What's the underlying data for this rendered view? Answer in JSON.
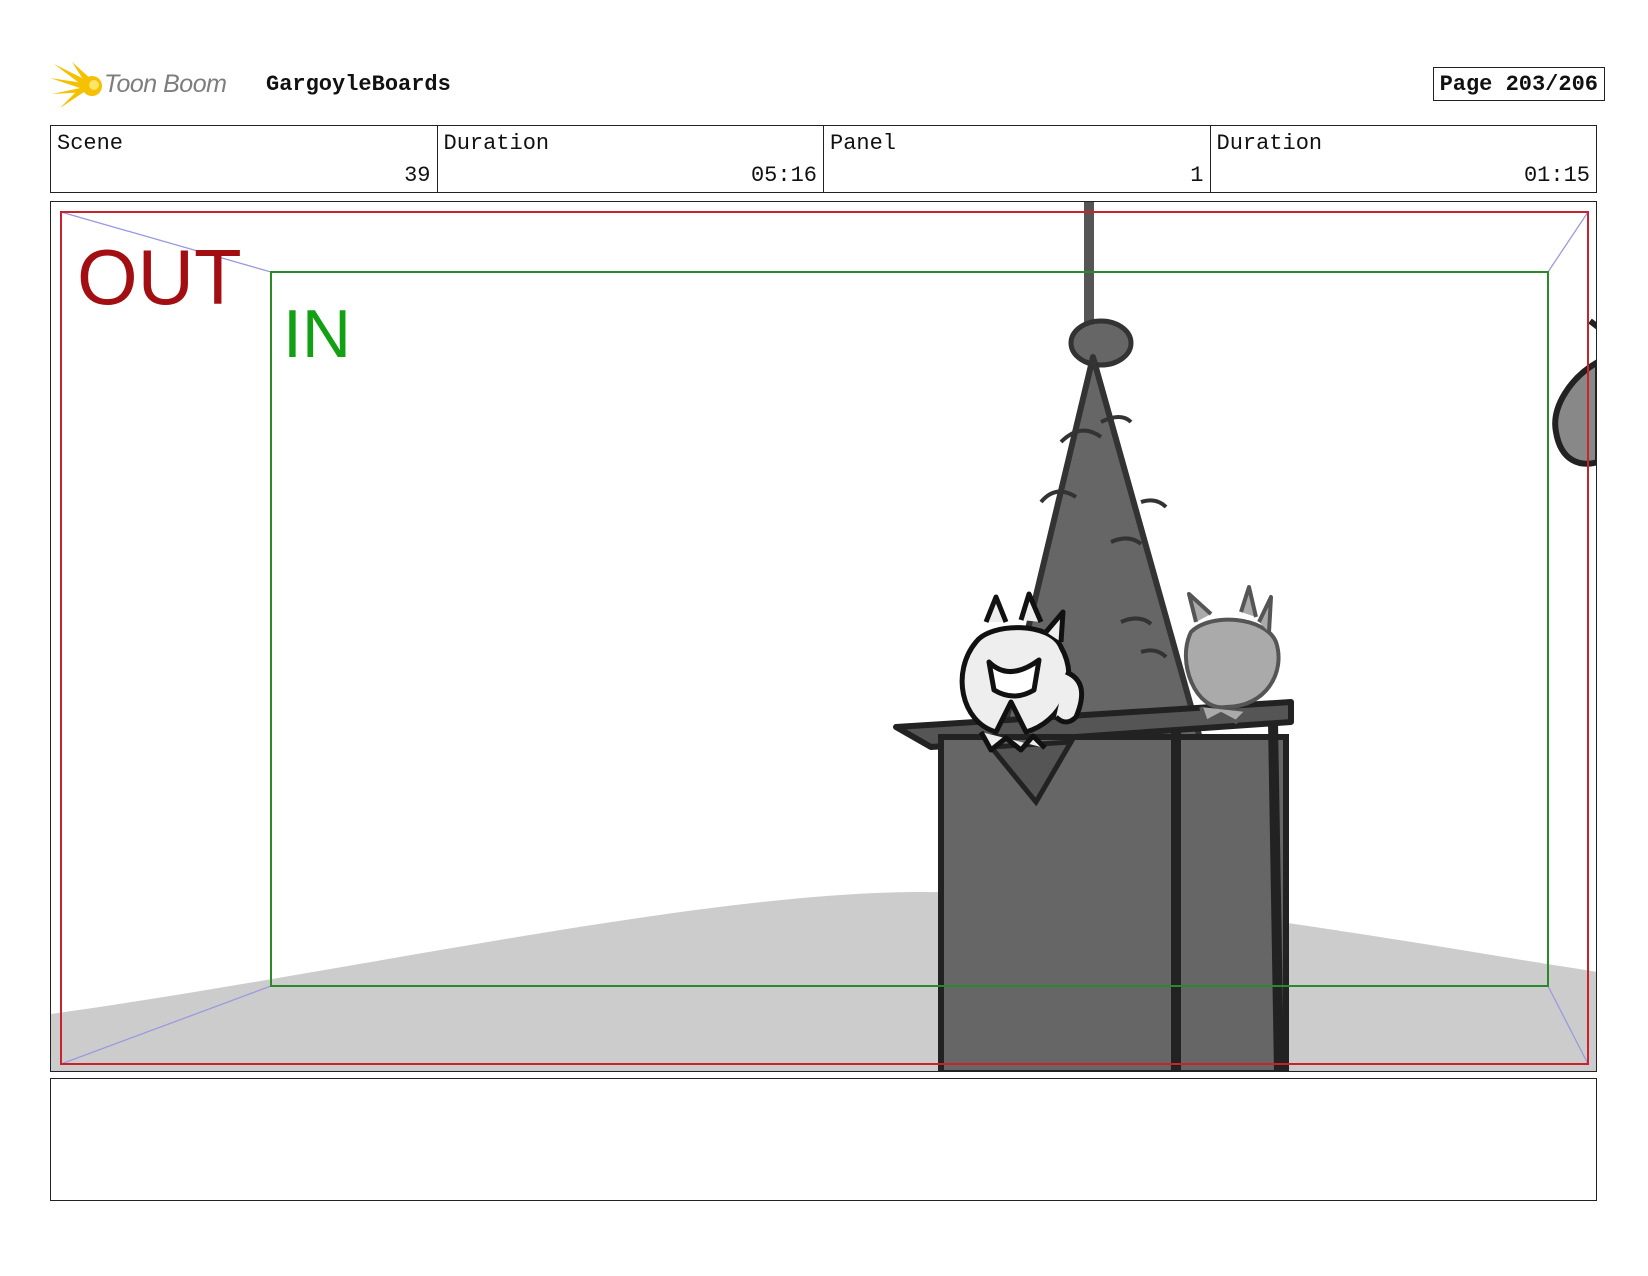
{
  "header": {
    "brand": "Toon Boom",
    "project": "GargoyleBoards",
    "page_label": "Page 203/206"
  },
  "info": [
    {
      "label": "Scene",
      "value": "39"
    },
    {
      "label": "Duration",
      "value": "05:16"
    },
    {
      "label": "Panel",
      "value": "1"
    },
    {
      "label": "Duration",
      "value": "01:15"
    }
  ],
  "panel": {
    "out_label": "OUT",
    "in_label": "IN"
  },
  "notes": {
    "text": ""
  },
  "colors": {
    "out_frame": "#c8232c",
    "in_frame": "#2a8a2a",
    "logo_accent": "#f5c000",
    "tower": "#666666",
    "ground": "#cccccc"
  }
}
